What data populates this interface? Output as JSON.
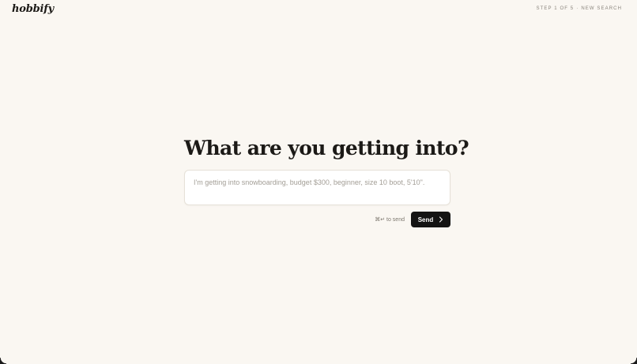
{
  "header": {
    "logo": "hobbify",
    "step_label": "STEP 1 OF 5",
    "separator": "·",
    "new_search_label": "NEW SEARCH"
  },
  "main": {
    "title": "What are you getting into?",
    "prompt_placeholder": "I'm getting into snowboarding, budget $300, beginner, size 10 boot, 5'10\".",
    "prompt_value": "",
    "hint": "⌘↵ to send",
    "send_label": "Send",
    "send_icon": "chevron-right-icon"
  },
  "colors": {
    "background": "#faf7f2",
    "text": "#1c1a17",
    "button": "#141414",
    "muted": "#8a857d"
  }
}
